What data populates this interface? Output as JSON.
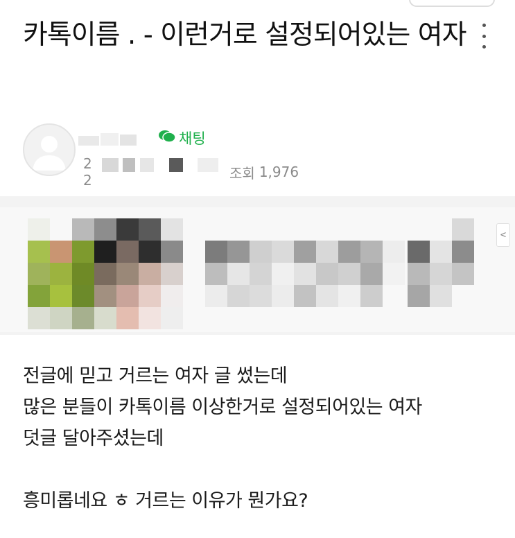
{
  "post": {
    "title": "카톡이름 . - 이런거로 설정되어있는 여자"
  },
  "author": {
    "name": "",
    "chat_label": "채팅",
    "date_prefix": "2",
    "date_suffix": "2",
    "views_label": "조회",
    "views": "1,976"
  },
  "body": {
    "lines": [
      "전글에 믿고 거르는 여자 글 썼는데",
      "많은 분들이 카톡이름 이상한거로 설정되어있는 여자",
      "덧글 달아주셨는데",
      "",
      "흥미롭네요 ㅎ 거르는 이유가 뭔가요?"
    ]
  },
  "icons": {
    "more": "more-vertical-icon",
    "chat": "chat-bubble-icon",
    "avatar": "default-avatar-icon"
  },
  "colors": {
    "chat_green": "#1fb04c",
    "meta_gray": "#8a8a8a"
  }
}
